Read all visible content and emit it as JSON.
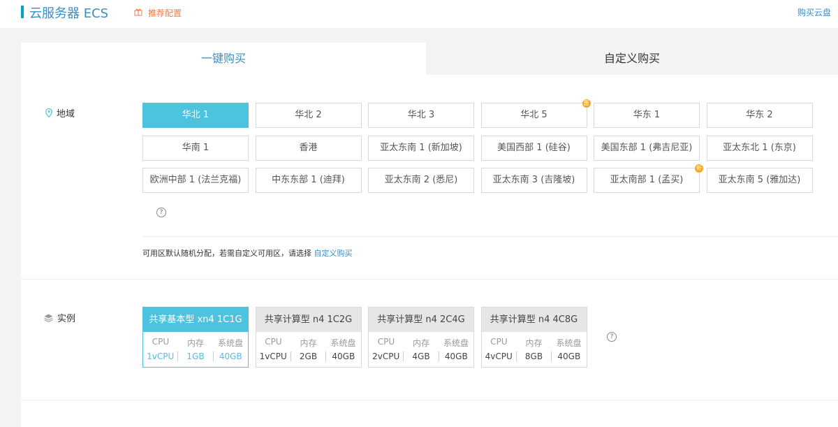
{
  "header": {
    "title": "云服务器 ECS",
    "recommend": "推荐配置",
    "buy_disk": "购买云盘"
  },
  "tabs": [
    {
      "label": "一键购买",
      "active": true
    },
    {
      "label": "自定义购买",
      "active": false
    }
  ],
  "region": {
    "label": "地域",
    "options": [
      {
        "label": "华北 1",
        "selected": true
      },
      {
        "label": "华北 2"
      },
      {
        "label": "华北 3"
      },
      {
        "label": "华北 5",
        "badge": "惠"
      },
      {
        "label": "华东 1"
      },
      {
        "label": "华东 2"
      },
      {
        "label": "华南 1"
      },
      {
        "label": "香港"
      },
      {
        "label": "亚太东南 1 (新加坡)"
      },
      {
        "label": "美国西部 1 (硅谷)"
      },
      {
        "label": "美国东部 1 (弗吉尼亚)"
      },
      {
        "label": "亚太东北 1 (东京)"
      },
      {
        "label": "欧洲中部 1 (法兰克福)"
      },
      {
        "label": "中东东部 1 (迪拜)"
      },
      {
        "label": "亚太东南 2 (悉尼)"
      },
      {
        "label": "亚太东南 3 (吉隆坡)"
      },
      {
        "label": "亚太南部 1 (孟买)",
        "badge": "新"
      },
      {
        "label": "亚太东南 5 (雅加达)"
      }
    ],
    "note": "可用区默认随机分配，若需自定义可用区，请选择",
    "note_link": "自定义购买"
  },
  "instance": {
    "label": "实例",
    "col_labels": [
      "CPU",
      "内存",
      "系统盘"
    ],
    "options": [
      {
        "title": "共享基本型 xn4 1C1G",
        "values": [
          "1vCPU",
          "1GB",
          "40GB"
        ],
        "selected": true
      },
      {
        "title": "共享计算型 n4 1C2G",
        "values": [
          "1vCPU",
          "2GB",
          "40GB"
        ]
      },
      {
        "title": "共享计算型 n4 2C4G",
        "values": [
          "2vCPU",
          "4GB",
          "40GB"
        ]
      },
      {
        "title": "共享计算型 n4 4C8G",
        "values": [
          "4vCPU",
          "8GB",
          "40GB"
        ]
      }
    ]
  },
  "colors": {
    "accent": "#4dc3de",
    "link": "#3a8ec4",
    "orange": "#f47a3f",
    "badge": "#f5a623"
  }
}
